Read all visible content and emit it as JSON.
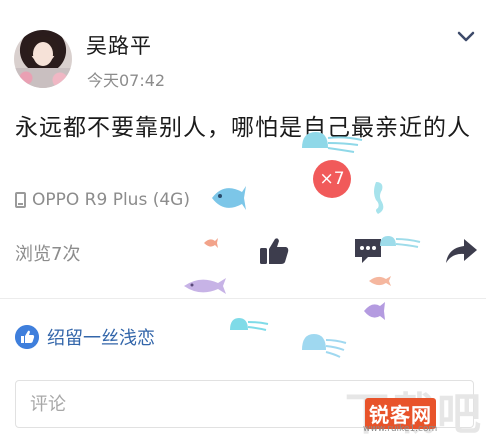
{
  "post": {
    "author": "吴路平",
    "time": "今天07:42",
    "text": "永远都不要靠别人，哪怕是自己最亲近的人",
    "device": "OPPO R9 Plus (4G)",
    "views": "浏览7次"
  },
  "likes": {
    "liker": "绍留一丝浅恋",
    "count_badge": "×7"
  },
  "comment_box": {
    "placeholder": "评论"
  },
  "watermark": {
    "brand": "锐客网",
    "bg": "下载吧",
    "sub": "www.ruike1.com"
  },
  "icons": {
    "more": "chevron-down-icon",
    "device": "phone-icon",
    "like": "thumbs-up-icon",
    "comment": "comment-bubble-icon",
    "share": "share-arrow-icon",
    "liked": "thumbs-up-badge-icon"
  },
  "colors": {
    "accent": "#3f7fdc",
    "badge": "#f15a5a",
    "icon": "#3d3d4d",
    "muted": "#8c8c8c"
  }
}
